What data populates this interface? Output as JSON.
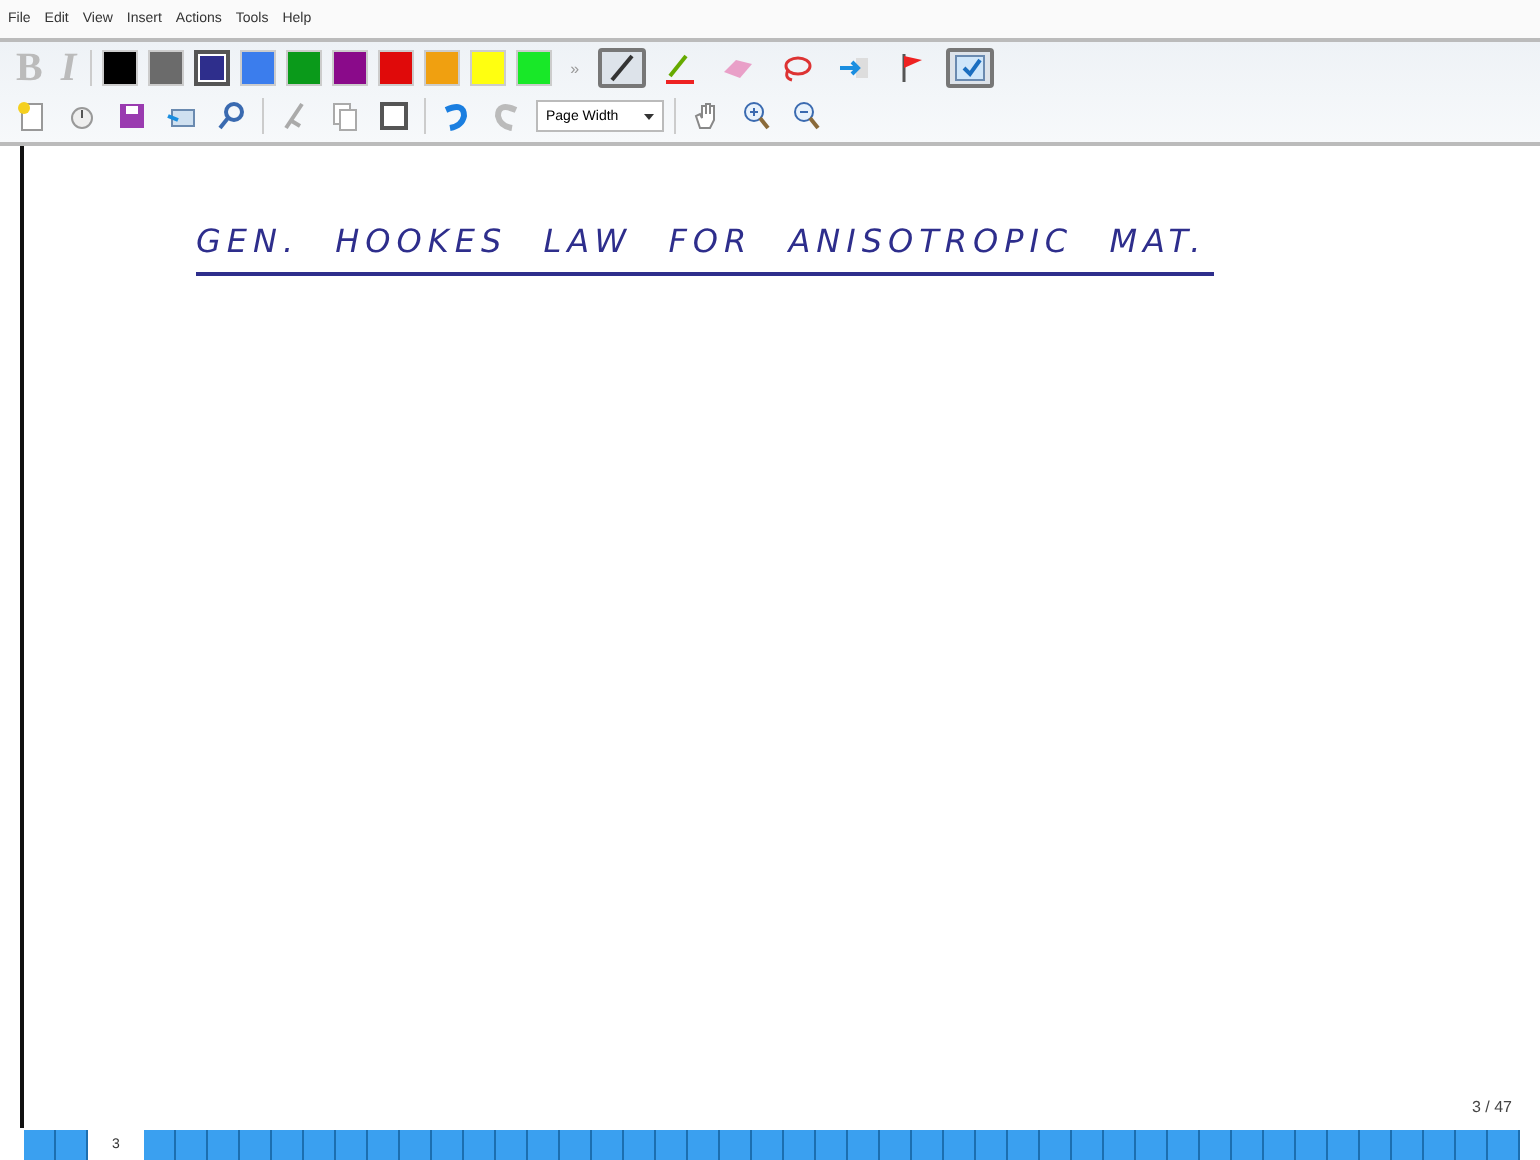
{
  "menu": [
    "File",
    "Edit",
    "View",
    "Insert",
    "Actions",
    "Tools",
    "Help"
  ],
  "format_buttons": [
    "B",
    "I"
  ],
  "colors": [
    {
      "color": "#000000",
      "selected": false
    },
    {
      "color": "#6b6b6b",
      "selected": false
    },
    {
      "color": "#2e2e8c",
      "selected": true
    },
    {
      "color": "#3b7ded",
      "selected": false
    },
    {
      "color": "#0a9a1a",
      "selected": false
    },
    {
      "color": "#8a0a8a",
      "selected": false
    },
    {
      "color": "#e00a0a",
      "selected": false
    },
    {
      "color": "#f0a010",
      "selected": false
    },
    {
      "color": "#ffff10",
      "selected": false
    },
    {
      "color": "#18e828",
      "selected": false
    }
  ],
  "more_label": "»",
  "tools": [
    {
      "kind": "pen",
      "selected": true
    },
    {
      "kind": "highlighter",
      "selected": false
    },
    {
      "kind": "eraser",
      "selected": false
    },
    {
      "kind": "lasso",
      "selected": false
    },
    {
      "kind": "space",
      "selected": false
    },
    {
      "kind": "flag",
      "selected": false
    },
    {
      "kind": "view",
      "selected": true
    }
  ],
  "zoom_select": {
    "value": "Page Width"
  },
  "note": {
    "heading": "GEN. HOOKES LAW FOR ANISOTROPIC MAT.",
    "page_indicator": "3 / 47"
  },
  "pages": {
    "current_label": "3"
  }
}
